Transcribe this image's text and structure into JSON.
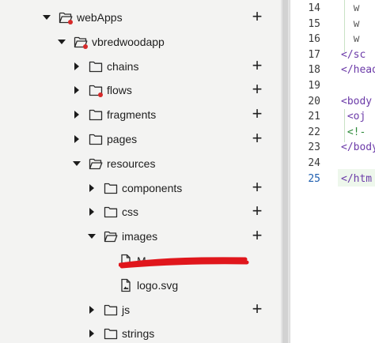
{
  "tree": {
    "items": [
      {
        "label": "webApps",
        "expanded": true,
        "icon": "folder-open-icon",
        "badge": true,
        "add": true
      },
      {
        "label": "vbredwoodapp",
        "expanded": true,
        "icon": "folder-open-icon",
        "badge": true,
        "add": false
      },
      {
        "label": "chains",
        "expanded": false,
        "icon": "folder-icon",
        "badge": false,
        "add": true
      },
      {
        "label": "flows",
        "expanded": false,
        "icon": "folder-icon",
        "badge": true,
        "add": true
      },
      {
        "label": "fragments",
        "expanded": false,
        "icon": "folder-icon",
        "badge": false,
        "add": true
      },
      {
        "label": "pages",
        "expanded": false,
        "icon": "folder-icon",
        "badge": false,
        "add": true
      },
      {
        "label": "resources",
        "expanded": true,
        "icon": "folder-open-icon",
        "badge": false,
        "add": false
      },
      {
        "label": "components",
        "expanded": false,
        "icon": "folder-icon",
        "badge": false,
        "add": true
      },
      {
        "label": "css",
        "expanded": false,
        "icon": "folder-icon",
        "badge": false,
        "add": true
      },
      {
        "label": "images",
        "expanded": true,
        "icon": "folder-open-icon",
        "badge": false,
        "add": true
      },
      {
        "label": "M",
        "expanded": null,
        "icon": "file-icon",
        "badge": false,
        "add": false,
        "redacted": true
      },
      {
        "label": "logo.svg",
        "expanded": null,
        "icon": "file-icon",
        "badge": false,
        "add": false
      },
      {
        "label": "js",
        "expanded": false,
        "icon": "folder-icon",
        "badge": false,
        "add": true
      },
      {
        "label": "strings",
        "expanded": false,
        "icon": "folder-icon",
        "badge": false,
        "add": false
      }
    ],
    "add_symbol": "+"
  },
  "editor": {
    "line_numbers": [
      "14",
      "15",
      "16",
      "17",
      "18",
      "19",
      "20",
      "21",
      "22",
      "23",
      "24",
      "25"
    ],
    "active_line": "25",
    "lines": [
      {
        "text": "  w",
        "color": "#5a5a5a"
      },
      {
        "text": "  w",
        "color": "#5a5a5a"
      },
      {
        "text": "  w",
        "color": "#5a5a5a"
      },
      {
        "text": "</sc",
        "color": "#6b3aa8"
      },
      {
        "text": "</head",
        "color": "#6b3aa8"
      },
      {
        "text": "",
        "color": "#333333"
      },
      {
        "text": "<body",
        "color": "#6b3aa8"
      },
      {
        "text": " <oj",
        "color": "#6b3aa8"
      },
      {
        "text": " <!-",
        "color": "#2e8b3a"
      },
      {
        "text": "</body",
        "color": "#6b3aa8"
      },
      {
        "text": "",
        "color": "#333333"
      },
      {
        "text": "</htm",
        "color": "#6b3aa8"
      }
    ]
  },
  "colors": {
    "badge": "#d62a2a",
    "redaction": "#e0161c",
    "panel_bg": "#f3f3f2"
  }
}
